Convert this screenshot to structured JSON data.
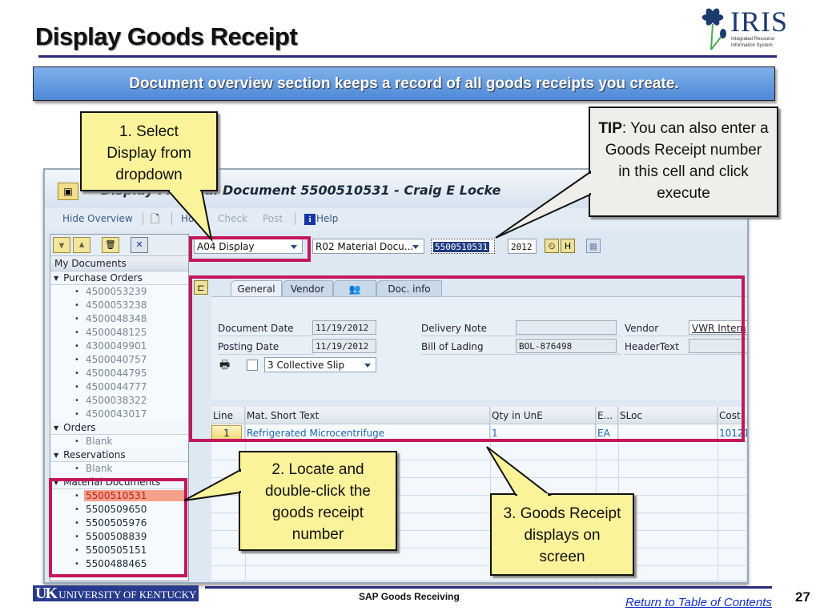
{
  "slide": {
    "title": "Display Goods Receipt",
    "banner": "Document overview section keeps a record of all goods receipts you create.",
    "logo": {
      "word": "IRIS",
      "subtitle_line1": "Integrated Resource",
      "subtitle_line2": "Information System",
      "icon": "iris-flower-icon"
    }
  },
  "sap": {
    "window_title": "Display Material Document 5500510531 - Craig E Locke",
    "toolbar": {
      "hide_overview": "Hide Overview",
      "hold": "Hold",
      "check": "Check",
      "post": "Post",
      "help": "Help",
      "help_icon_glyph": "i"
    },
    "overview": {
      "header": "My Documents",
      "groups": [
        {
          "label": "Purchase Orders",
          "items": [
            "4500053239",
            "4500053238",
            "4500048348",
            "4500048125",
            "4300049901",
            "4500040757",
            "4500044795",
            "4500044777",
            "4500038322",
            "4500043017"
          ]
        },
        {
          "label": "Orders",
          "items": [
            "Blank"
          ]
        },
        {
          "label": "Reservations",
          "items": [
            "Blank"
          ]
        },
        {
          "label": "Material Documents",
          "items": [
            "5500510531",
            "5500509650",
            "5500505976",
            "5500508839",
            "5500505151",
            "5500488465"
          ],
          "selected": "5500510531"
        }
      ]
    },
    "selectors": {
      "action": "A04 Display",
      "reference": "R02 Material Docu...",
      "document_number": "5500510531",
      "year": "2012"
    },
    "tabs": [
      "General",
      "Vendor",
      "",
      "Doc. info"
    ],
    "active_tab": "General",
    "general": {
      "document_date_label": "Document Date",
      "document_date": "11/19/2012",
      "posting_date_label": "Posting Date",
      "posting_date": "11/19/2012",
      "slip_option": "3 Collective Slip",
      "delivery_note_label": "Delivery Note",
      "delivery_note": "",
      "bill_of_lading_label": "Bill of Lading",
      "bill_of_lading": "BOL-876498",
      "vendor_label": "Vendor",
      "vendor": "VWR Intern",
      "header_text_label": "HeaderText",
      "header_text": ""
    },
    "items_table": {
      "columns": [
        "Line",
        "Mat. Short Text",
        "Qty in UnE",
        "E...",
        "SLoc",
        "Cost C"
      ],
      "rows": [
        {
          "line": "1",
          "mat_short_text": "Refrigerated Microcentrifuge",
          "qty": "1",
          "unit": "EA",
          "sloc": "",
          "cost": "10121"
        }
      ]
    }
  },
  "callouts": {
    "step1": "1. Select Display from dropdown",
    "step2": "2. Locate and double-click the goods receipt number",
    "step3": "3. Goods Receipt displays on screen",
    "tip_bold": "TIP",
    "tip_text": ": You can also enter a Goods Receipt number in this cell and click execute"
  },
  "footer": {
    "university_logo_uk": "UK",
    "university_logo_text": "UNIVERSITY OF KENTUCKY",
    "center": "SAP Goods Receiving",
    "link": "Return to Table of Contents",
    "page_number": "27"
  }
}
